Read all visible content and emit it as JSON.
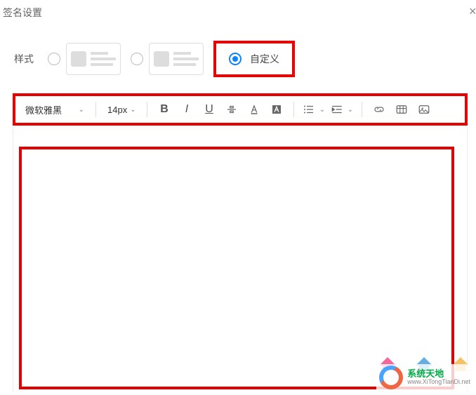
{
  "dialog": {
    "title": "签名设置"
  },
  "style_row": {
    "label": "样式",
    "custom_label": "自定义"
  },
  "toolbar": {
    "font": "微软雅黑",
    "size": "14px"
  },
  "editor": {
    "content": ""
  },
  "watermark": {
    "cn": "系统天地",
    "en": "www.XiTongTianDi.net"
  }
}
